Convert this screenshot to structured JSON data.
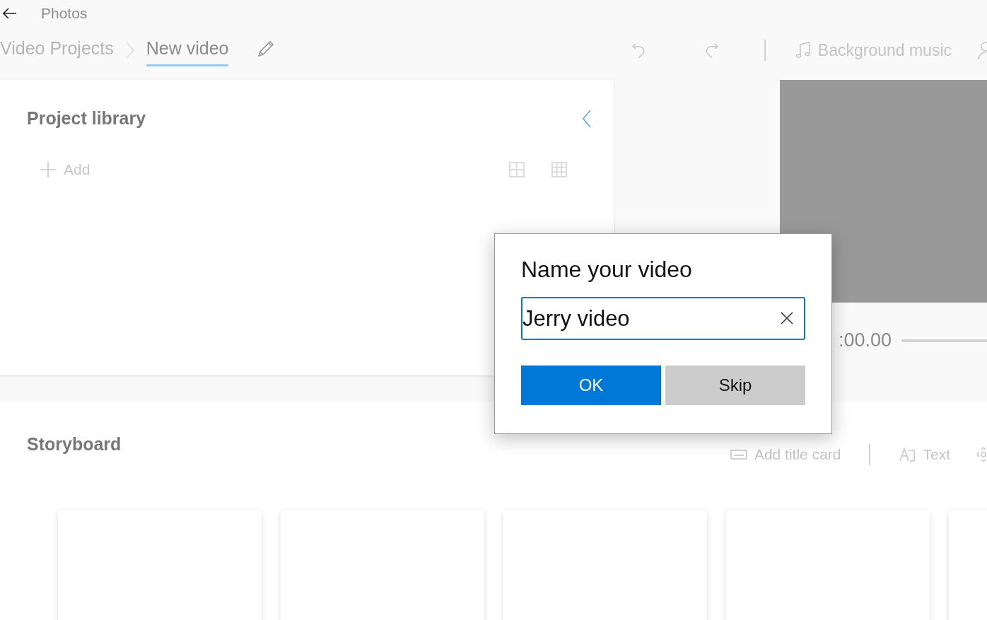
{
  "app": {
    "title": "Photos"
  },
  "breadcrumb": [
    {
      "label": "Video Projects",
      "selected": false
    },
    {
      "label": "New video",
      "selected": true
    }
  ],
  "toolbar": {
    "background_music": "Background music"
  },
  "library": {
    "title": "Project library",
    "add": "Add"
  },
  "preview": {
    "time": ":00.00"
  },
  "storyboard": {
    "title": "Storyboard",
    "actions": [
      {
        "label": "Add title card",
        "kind": "title-card"
      },
      {
        "label": "Text",
        "kind": "text"
      }
    ],
    "slots": [
      {
        "kind": "blank"
      },
      {
        "kind": "blank"
      },
      {
        "kind": "blank"
      },
      {
        "kind": "blank"
      },
      {
        "kind": "blank"
      }
    ]
  },
  "dialog": {
    "title": "Name your video",
    "value": "Jerry video",
    "buttons": [
      {
        "label": "OK",
        "kind": "primary"
      },
      {
        "label": "Skip",
        "kind": "secondary"
      }
    ]
  }
}
